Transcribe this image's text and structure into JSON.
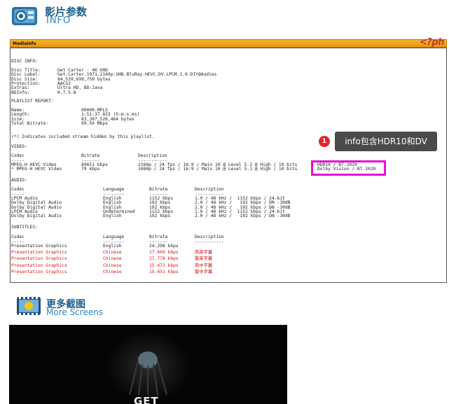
{
  "header": {
    "title_cn": "影片参数",
    "title_en": "INFO"
  },
  "panel": {
    "label": "Mediainfo",
    "logo": "<?ph"
  },
  "disc": {
    "heading": "DISC INFO:",
    "rows": [
      {
        "k": "Disc Title:",
        "v": "Get Carter - 4K UHD"
      },
      {
        "k": "Disc Label:",
        "v": "Get.Carter.1971.2160p.UHD.BluRay.HEVC.DV.LPCM.1.0-DIY@Audies"
      },
      {
        "k": "Disc Size:",
        "v": "84,539,699,750 bytes"
      },
      {
        "k": "Protection:",
        "v": "AACS2"
      },
      {
        "k": "Extras:",
        "v": "Ultra HD, BD-Java"
      },
      {
        "k": "BDInfo:",
        "v": "0.7.5.8"
      }
    ]
  },
  "playlist": {
    "heading": "PLAYLIST REPORT:",
    "rows": [
      {
        "k": "Name:",
        "v": "00000.MPLS"
      },
      {
        "k": "Length:",
        "v": "1:51:37.833 (h:m:s.ms)"
      },
      {
        "k": "Size:",
        "v": "83,307,526,464 bytes"
      },
      {
        "k": "Total Bitrate:",
        "v": "99.50 Mbps"
      }
    ],
    "note": "(*) Indicates included stream hidden by this playlist."
  },
  "video": {
    "heading": "VIDEO:",
    "headers": [
      "Codec",
      "Bitrate",
      "Description"
    ],
    "dashes": [
      "-----",
      "-------",
      "-----------"
    ],
    "rows": [
      {
        "codec": "MPEG-H HEVC Video",
        "bitrate": "89651 kbps",
        "desc": "2160p / 24 fps / 16:9 / Main 10 @ Level 5.1 @ High / 10 bits",
        "extra": "HDR10 / BT.2020"
      },
      {
        "codec": "* MPEG-H HEVC Video",
        "bitrate": "79 kbps",
        "desc": "1080p / 24 fps / 16:9 / Main 10 @ Level 5.1 @ High / 10 bits",
        "extra": "Dolby Vision / BT.2020"
      }
    ]
  },
  "audio": {
    "heading": "AUDIO:",
    "headers": [
      "Codec",
      "Language",
      "Bitrate",
      "Description"
    ],
    "dashes": [
      "-----",
      "--------",
      "-------",
      "-----------"
    ],
    "rows": [
      {
        "codec": "LPCM Audio",
        "lang": "English",
        "bitrate": "1152 kbps",
        "desc": "1.0 / 48 kHz /  1152 kbps / 24-bit"
      },
      {
        "codec": "Dolby Digital Audio",
        "lang": "English",
        "bitrate": "192 kbps",
        "desc": "2.0 / 48 kHz /   192 kbps / DN -30dB"
      },
      {
        "codec": "Dolby Digital Audio",
        "lang": "English",
        "bitrate": "192 kbps",
        "desc": "2.0 / 48 kHz /   192 kbps / DN -30dB"
      },
      {
        "codec": "LPCM Audio",
        "lang": "Undetermined",
        "bitrate": "1152 kbps",
        "desc": "1.0 / 48 kHz /  1152 kbps / 24-bit"
      },
      {
        "codec": "Dolby Digital Audio",
        "lang": "English",
        "bitrate": "192 kbps",
        "desc": "2.0 / 48 kHz /   192 kbps / DN -30dB"
      }
    ]
  },
  "subtitles": {
    "heading": "SUBTITLES:",
    "headers": [
      "Codec",
      "Language",
      "Bitrate",
      "Description"
    ],
    "dashes": [
      "-----",
      "--------",
      "-------",
      "-----------"
    ],
    "rows": [
      {
        "codec": "Presentation Graphics",
        "lang": "English",
        "bitrate": "24.298 kbps",
        "desc": ""
      },
      {
        "codec": "Presentation Graphics",
        "lang": "Chinese",
        "bitrate": "27.600 kbps",
        "desc": "简英字幕"
      },
      {
        "codec": "Presentation Graphics",
        "lang": "Chinese",
        "bitrate": "27.778 kbps",
        "desc": "繁英字幕"
      },
      {
        "codec": "Presentation Graphics",
        "lang": "Chinese",
        "bitrate": "15.473 kbps",
        "desc": "简中字幕"
      },
      {
        "codec": "Presentation Graphics",
        "lang": "Chinese",
        "bitrate": "15.651 kbps",
        "desc": "繁中字幕"
      }
    ]
  },
  "callout": {
    "number": "1",
    "text": "info包含HDR10和DV"
  },
  "more": {
    "title_cn": "更多截图",
    "title_en": "More Screens"
  },
  "screenshot": {
    "caption": "GET"
  },
  "colors": {
    "accent": "#1c5f8c",
    "highlight": "#e60fd7",
    "red_text": "#d21414",
    "bar": "#f0a51e"
  }
}
